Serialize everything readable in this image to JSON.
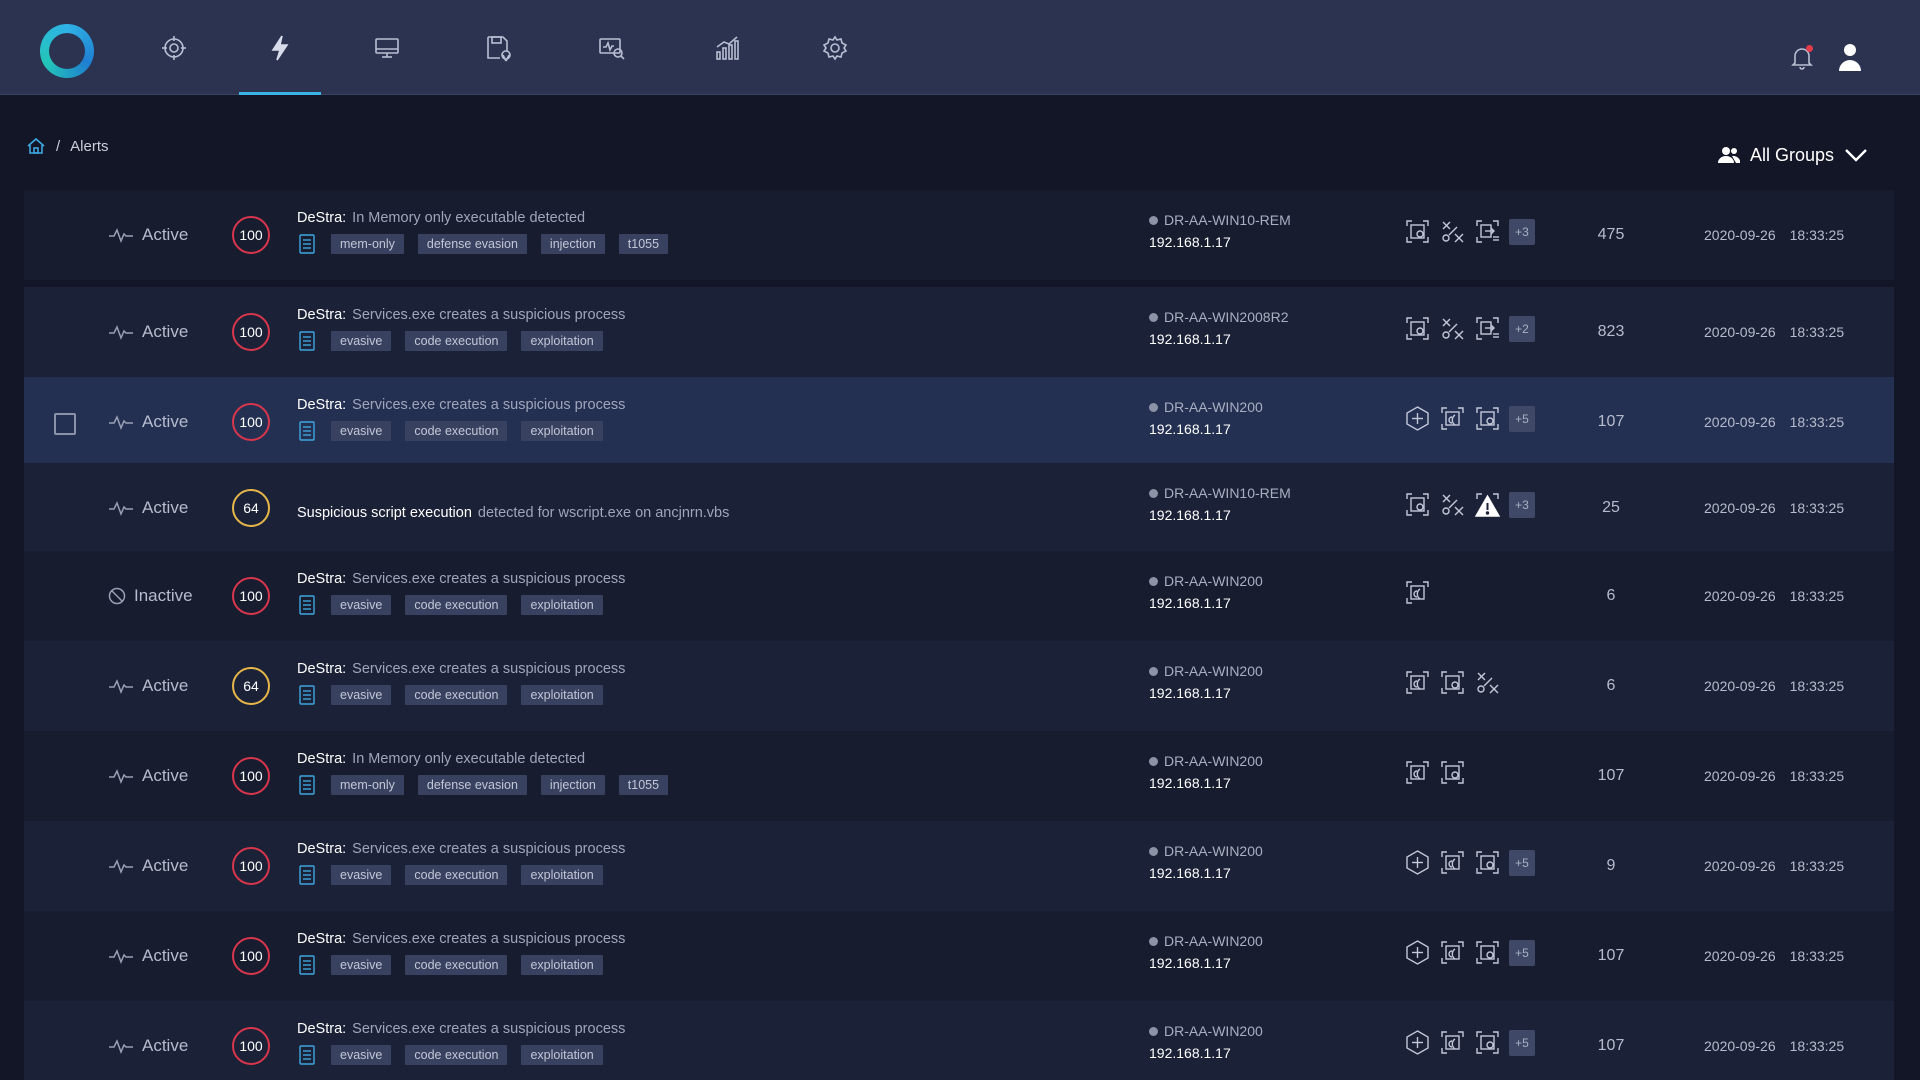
{
  "nav": {
    "items": [
      {
        "name": "targets",
        "icon": "crosshair-icon"
      },
      {
        "name": "alerts",
        "icon": "lightning-icon",
        "active": true
      },
      {
        "name": "endpoints",
        "icon": "monitor-icon"
      },
      {
        "name": "storage",
        "icon": "save-location-icon"
      },
      {
        "name": "investigate",
        "icon": "monitor-search-icon"
      },
      {
        "name": "reports",
        "icon": "bar-chart-icon"
      },
      {
        "name": "settings",
        "icon": "gear-icon"
      }
    ],
    "accent": "#3bb3e6"
  },
  "breadcrumb": {
    "current": "Alerts"
  },
  "groups": {
    "label": "All Groups"
  },
  "alerts": [
    {
      "status": "Active",
      "score": "100",
      "severity": "high",
      "source": "DeStra:",
      "title": "In Memory only executable detected",
      "tags": [
        "mem-only",
        "defense evasion",
        "injection",
        "t1055"
      ],
      "host": "DR-AA-WIN10-REM",
      "ip": "192.168.1.17",
      "icons": [
        "capture",
        "disconnect",
        "export"
      ],
      "more": "+3",
      "count": "475",
      "date": "2020-09-26",
      "time": "18:33:25"
    },
    {
      "status": "Active",
      "score": "100",
      "severity": "high",
      "source": "DeStra:",
      "title": "Services.exe creates a suspicious process",
      "tags": [
        "evasive",
        "code execution",
        "exploitation"
      ],
      "host": "DR-AA-WIN2008R2",
      "ip": "192.168.1.17",
      "icons": [
        "capture",
        "disconnect",
        "export"
      ],
      "more": "+2",
      "count": "823",
      "date": "2020-09-26",
      "time": "18:33:25"
    },
    {
      "status": "Active",
      "score": "100",
      "severity": "high",
      "source": "DeStra:",
      "title": "Services.exe creates a suspicious process",
      "tags": [
        "evasive",
        "code execution",
        "exploitation"
      ],
      "host": "DR-AA-WIN200",
      "ip": "192.168.1.17",
      "icons": [
        "add",
        "broadcast",
        "capture"
      ],
      "more": "+5",
      "count": "107",
      "date": "2020-09-26",
      "time": "18:33:25"
    },
    {
      "status": "Active",
      "score": "64",
      "severity": "medium",
      "source": "Suspicious script execution",
      "title": "detected for wscript.exe on ancjnrn.vbs",
      "tags": [],
      "host": "DR-AA-WIN10-REM",
      "ip": "192.168.1.17",
      "icons": [
        "capture",
        "disconnect",
        "warning"
      ],
      "more": "+3",
      "count": "25",
      "date": "2020-09-26",
      "time": "18:33:25"
    },
    {
      "status": "Inactive",
      "score": "100",
      "severity": "high",
      "source": "DeStra:",
      "title": "Services.exe creates a suspicious process",
      "tags": [
        "evasive",
        "code execution",
        "exploitation"
      ],
      "host": "DR-AA-WIN200",
      "ip": "192.168.1.17",
      "icons": [
        "broadcast"
      ],
      "more": "",
      "count": "6",
      "date": "2020-09-26",
      "time": "18:33:25"
    },
    {
      "status": "Active",
      "score": "64",
      "severity": "medium",
      "source": "DeStra:",
      "title": "Services.exe creates a suspicious process",
      "tags": [
        "evasive",
        "code execution",
        "exploitation"
      ],
      "host": "DR-AA-WIN200",
      "ip": "192.168.1.17",
      "icons": [
        "broadcast",
        "capture",
        "disconnect"
      ],
      "more": "",
      "count": "6",
      "date": "2020-09-26",
      "time": "18:33:25"
    },
    {
      "status": "Active",
      "score": "100",
      "severity": "high",
      "source": "DeStra:",
      "title": "In Memory only executable detected",
      "tags": [
        "mem-only",
        "defense evasion",
        "injection",
        "t1055"
      ],
      "host": "DR-AA-WIN200",
      "ip": "192.168.1.17",
      "icons": [
        "broadcast",
        "capture"
      ],
      "more": "",
      "count": "107",
      "date": "2020-09-26",
      "time": "18:33:25"
    },
    {
      "status": "Active",
      "score": "100",
      "severity": "high",
      "source": "DeStra:",
      "title": "Services.exe creates a suspicious process",
      "tags": [
        "evasive",
        "code execution",
        "exploitation"
      ],
      "host": "DR-AA-WIN200",
      "ip": "192.168.1.17",
      "icons": [
        "add",
        "broadcast",
        "capture"
      ],
      "more": "+5",
      "count": "9",
      "date": "2020-09-26",
      "time": "18:33:25"
    },
    {
      "status": "Active",
      "score": "100",
      "severity": "high",
      "source": "DeStra:",
      "title": "Services.exe creates a suspicious process",
      "tags": [
        "evasive",
        "code execution",
        "exploitation"
      ],
      "host": "DR-AA-WIN200",
      "ip": "192.168.1.17",
      "icons": [
        "add",
        "broadcast",
        "capture"
      ],
      "more": "+5",
      "count": "107",
      "date": "2020-09-26",
      "time": "18:33:25"
    },
    {
      "status": "Active",
      "score": "100",
      "severity": "high",
      "source": "DeStra:",
      "title": "Services.exe creates a suspicious process",
      "tags": [
        "evasive",
        "code execution",
        "exploitation"
      ],
      "host": "DR-AA-WIN200",
      "ip": "192.168.1.17",
      "icons": [
        "add",
        "broadcast",
        "capture"
      ],
      "more": "+5",
      "count": "107",
      "date": "2020-09-26",
      "time": "18:33:25"
    }
  ],
  "colors": {
    "high": "#d8364c",
    "medium": "#e6b64a",
    "tag_bg": "#394160"
  }
}
